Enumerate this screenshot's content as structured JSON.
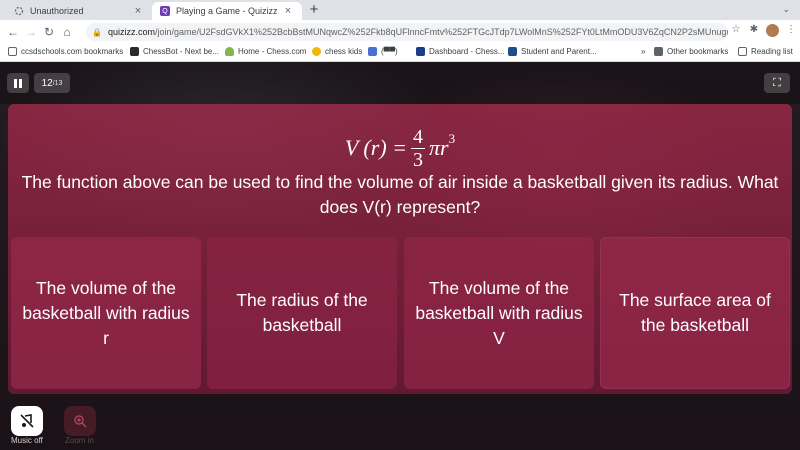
{
  "browser": {
    "tabs": [
      {
        "title": "Unauthorized",
        "active": false
      },
      {
        "title": "Playing a Game - Quizizz",
        "active": true
      }
    ],
    "url_host": "quizizz.com",
    "url_path": "/join/game/U2FsdGVkX1%252BcbBstMUNqwcZ%252Fkb8qUFlnncFmtv%252FTGcJTdp7LWolMnS%252FYt0LtMmODU3V6ZqCN2P2sMUnugmTiw%...",
    "bookmarks": [
      {
        "label": "ccsdschools.com bookmarks",
        "color": "#5f6368"
      },
      {
        "label": "ChessBot - Next be...",
        "color": "#2b2b2b"
      },
      {
        "label": "Home - Chess.com",
        "color": "#81b64c"
      },
      {
        "label": "chess kids",
        "color": "#f2b705"
      },
      {
        "label": "",
        "color": "#4a6fd1"
      },
      {
        "label": "Dashboard - Chess...",
        "color": "#1a3c8a"
      },
      {
        "label": "Student and Parent...",
        "color": "#1d4e89"
      },
      {
        "label": "Other bookmarks",
        "color": "#5f6368"
      },
      {
        "label": "Reading list",
        "color": "#5f6368"
      }
    ],
    "bookmarks_overflow": "»"
  },
  "quiz": {
    "counter_current": "12",
    "counter_total": "/13",
    "formula_lhs": "V (r) =",
    "formula_num": "4",
    "formula_den": "3",
    "formula_rhs": "πr",
    "formula_exp": "3",
    "question": "The function above can be used to find the volume of air inside a basketball given its radius. What does V(r) represent?",
    "options": [
      "The volume of the basketball with radius r",
      "The radius of the basketball",
      "The volume of the basketball with radius V",
      "The surface area of the basketball"
    ],
    "music_label": "Music off",
    "zoom_label": "Zoom in"
  },
  "icons": {
    "pause": "pause-icon",
    "fullscreen": "fullscreen-icon",
    "music": "music-off-icon",
    "zoom": "zoom-in-icon"
  },
  "colors": {
    "panel": "#962846",
    "option": "#962846"
  }
}
